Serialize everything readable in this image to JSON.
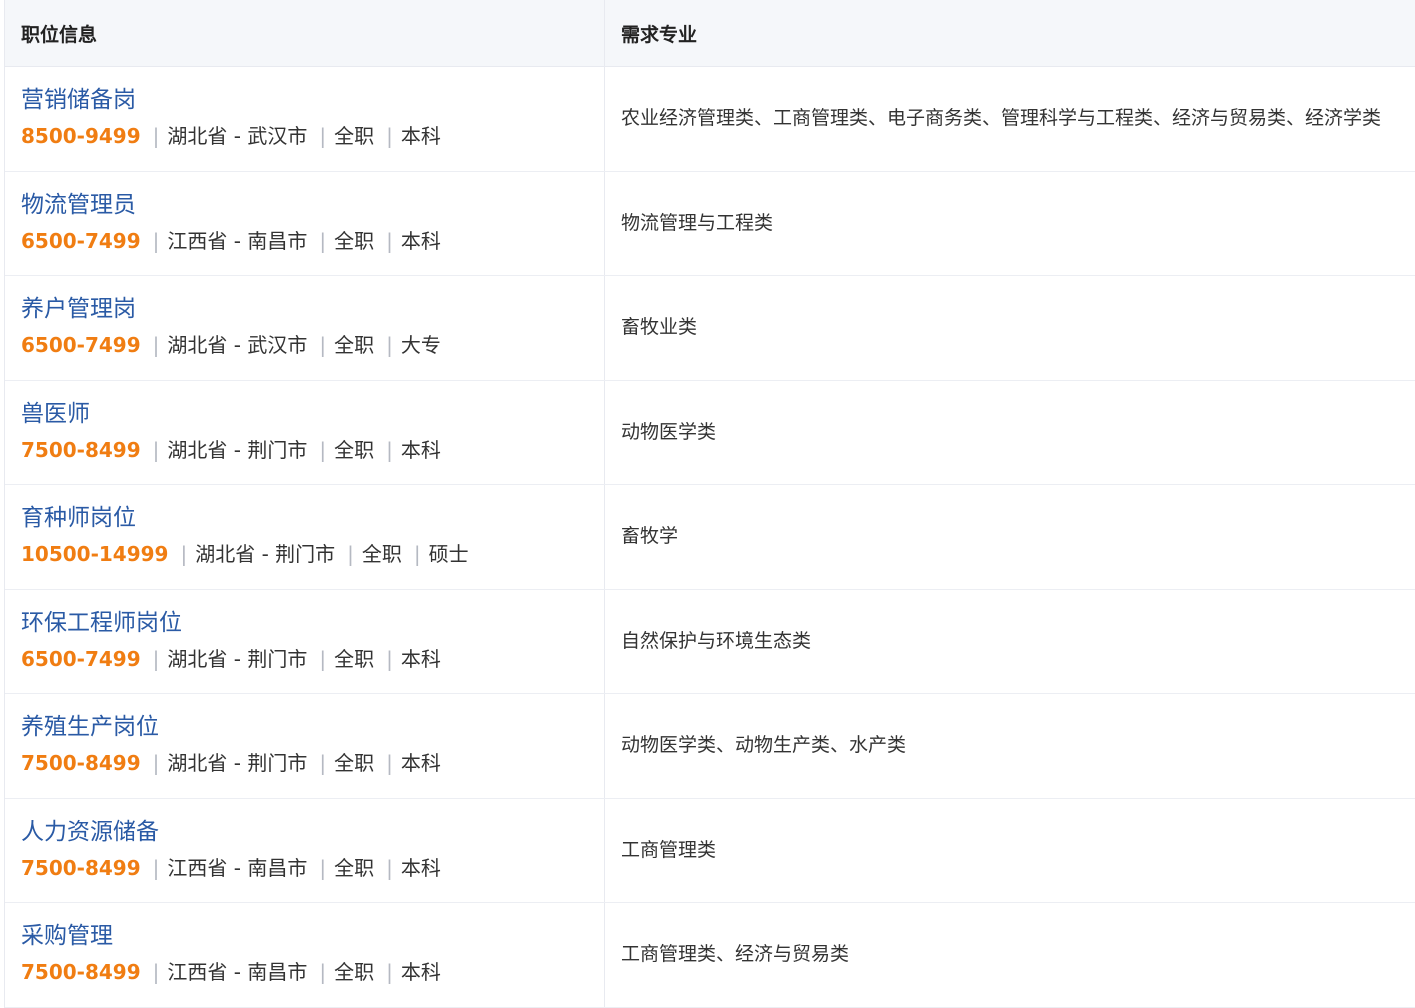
{
  "header": {
    "col_position": "职位信息",
    "col_major": "需求专业"
  },
  "rows": [
    {
      "title": "营销储备岗",
      "salary": "8500-9499",
      "province": "湖北省",
      "city": "武汉市",
      "type": "全职",
      "edu": "本科",
      "major": "农业经济管理类、工商管理类、电子商务类、管理科学与工程类、经济与贸易类、经济学类"
    },
    {
      "title": "物流管理员",
      "salary": "6500-7499",
      "province": "江西省",
      "city": "南昌市",
      "type": "全职",
      "edu": "本科",
      "major": "物流管理与工程类"
    },
    {
      "title": "养户管理岗",
      "salary": "6500-7499",
      "province": "湖北省",
      "city": "武汉市",
      "type": "全职",
      "edu": "大专",
      "major": "畜牧业类"
    },
    {
      "title": "兽医师",
      "salary": "7500-8499",
      "province": "湖北省",
      "city": "荆门市",
      "type": "全职",
      "edu": "本科",
      "major": "动物医学类"
    },
    {
      "title": "育种师岗位",
      "salary": "10500-14999",
      "province": "湖北省",
      "city": "荆门市",
      "type": "全职",
      "edu": "硕士",
      "major": "畜牧学"
    },
    {
      "title": "环保工程师岗位",
      "salary": "6500-7499",
      "province": "湖北省",
      "city": "荆门市",
      "type": "全职",
      "edu": "本科",
      "major": "自然保护与环境生态类"
    },
    {
      "title": "养殖生产岗位",
      "salary": "7500-8499",
      "province": "湖北省",
      "city": "荆门市",
      "type": "全职",
      "edu": "本科",
      "major": "动物医学类、动物生产类、水产类"
    },
    {
      "title": "人力资源储备",
      "salary": "7500-8499",
      "province": "江西省",
      "city": "南昌市",
      "type": "全职",
      "edu": "本科",
      "major": "工商管理类"
    },
    {
      "title": "采购管理",
      "salary": "7500-8499",
      "province": "江西省",
      "city": "南昌市",
      "type": "全职",
      "edu": "本科",
      "major": "工商管理类、经济与贸易类"
    }
  ]
}
